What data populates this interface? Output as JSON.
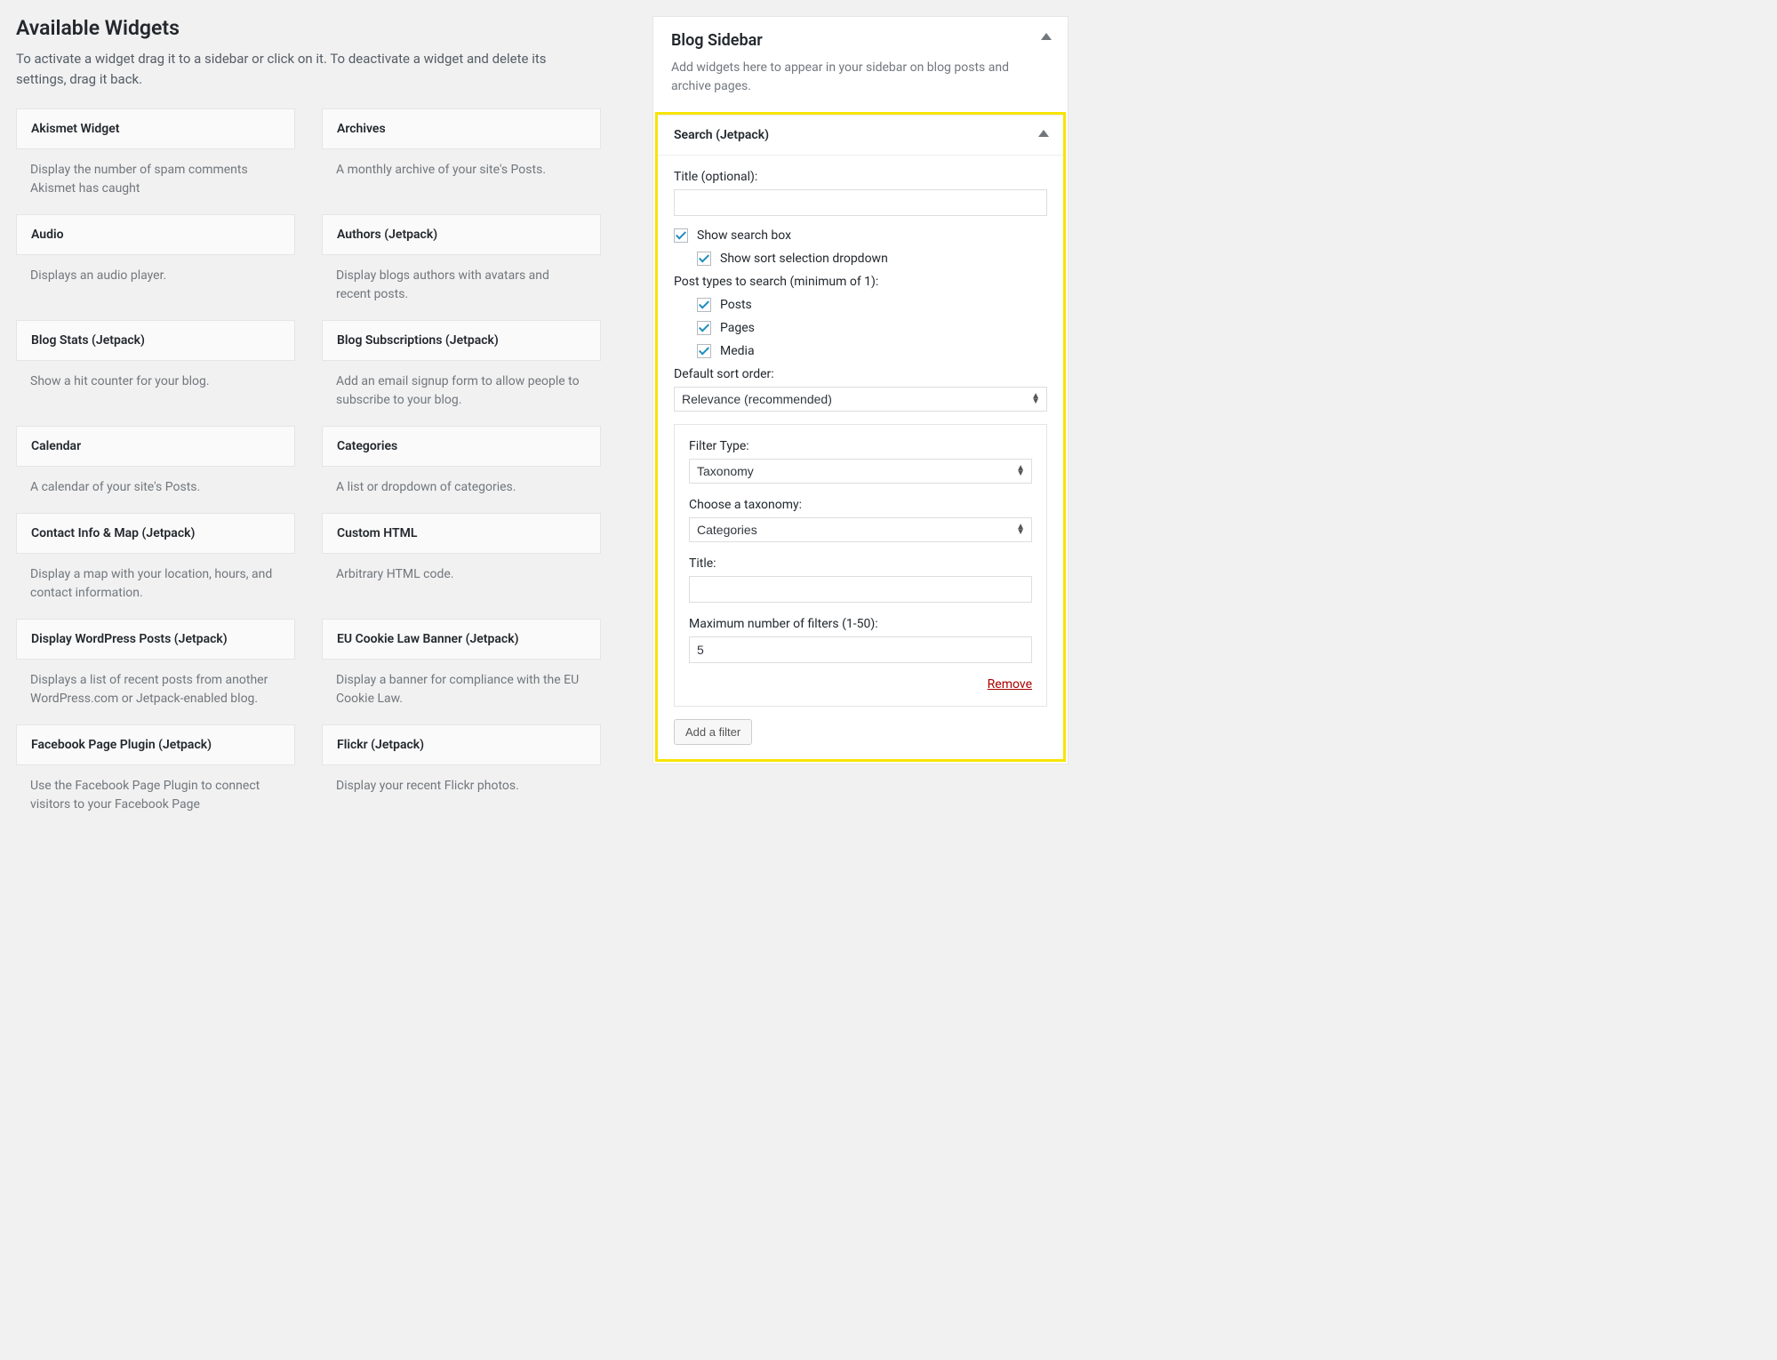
{
  "available": {
    "heading": "Available Widgets",
    "intro": "To activate a widget drag it to a sidebar or click on it. To deactivate a widget and delete its settings, drag it back.",
    "widgets": [
      {
        "title": "Akismet Widget",
        "desc": "Display the number of spam comments Akismet has caught"
      },
      {
        "title": "Archives",
        "desc": "A monthly archive of your site's Posts."
      },
      {
        "title": "Audio",
        "desc": "Displays an audio player."
      },
      {
        "title": "Authors (Jetpack)",
        "desc": "Display blogs authors with avatars and recent posts."
      },
      {
        "title": "Blog Stats (Jetpack)",
        "desc": "Show a hit counter for your blog."
      },
      {
        "title": "Blog Subscriptions (Jetpack)",
        "desc": "Add an email signup form to allow people to subscribe to your blog."
      },
      {
        "title": "Calendar",
        "desc": "A calendar of your site's Posts."
      },
      {
        "title": "Categories",
        "desc": "A list or dropdown of categories."
      },
      {
        "title": "Contact Info & Map (Jetpack)",
        "desc": "Display a map with your location, hours, and contact information."
      },
      {
        "title": "Custom HTML",
        "desc": "Arbitrary HTML code."
      },
      {
        "title": "Display WordPress Posts (Jetpack)",
        "desc": "Displays a list of recent posts from another WordPress.com or Jetpack-enabled blog."
      },
      {
        "title": "EU Cookie Law Banner (Jetpack)",
        "desc": "Display a banner for compliance with the EU Cookie Law."
      },
      {
        "title": "Facebook Page Plugin (Jetpack)",
        "desc": "Use the Facebook Page Plugin to connect visitors to your Facebook Page"
      },
      {
        "title": "Flickr (Jetpack)",
        "desc": "Display your recent Flickr photos."
      }
    ]
  },
  "sidebar": {
    "title": "Blog Sidebar",
    "desc": "Add widgets here to appear in your sidebar on blog posts and archive pages.",
    "widget": {
      "header": "Search (Jetpack)",
      "title_label": "Title (optional):",
      "title_value": "",
      "show_search_label": "Show search box",
      "show_sort_label": "Show sort selection dropdown",
      "post_types_label": "Post types to search (minimum of 1):",
      "pt_posts": "Posts",
      "pt_pages": "Pages",
      "pt_media": "Media",
      "sort_label": "Default sort order:",
      "sort_value": "Relevance (recommended)",
      "filter": {
        "type_label": "Filter Type:",
        "type_value": "Taxonomy",
        "tax_label": "Choose a taxonomy:",
        "tax_value": "Categories",
        "title_label": "Title:",
        "title_value": "",
        "max_label": "Maximum number of filters (1-50):",
        "max_value": "5",
        "remove": "Remove"
      },
      "add_filter": "Add a filter"
    }
  }
}
